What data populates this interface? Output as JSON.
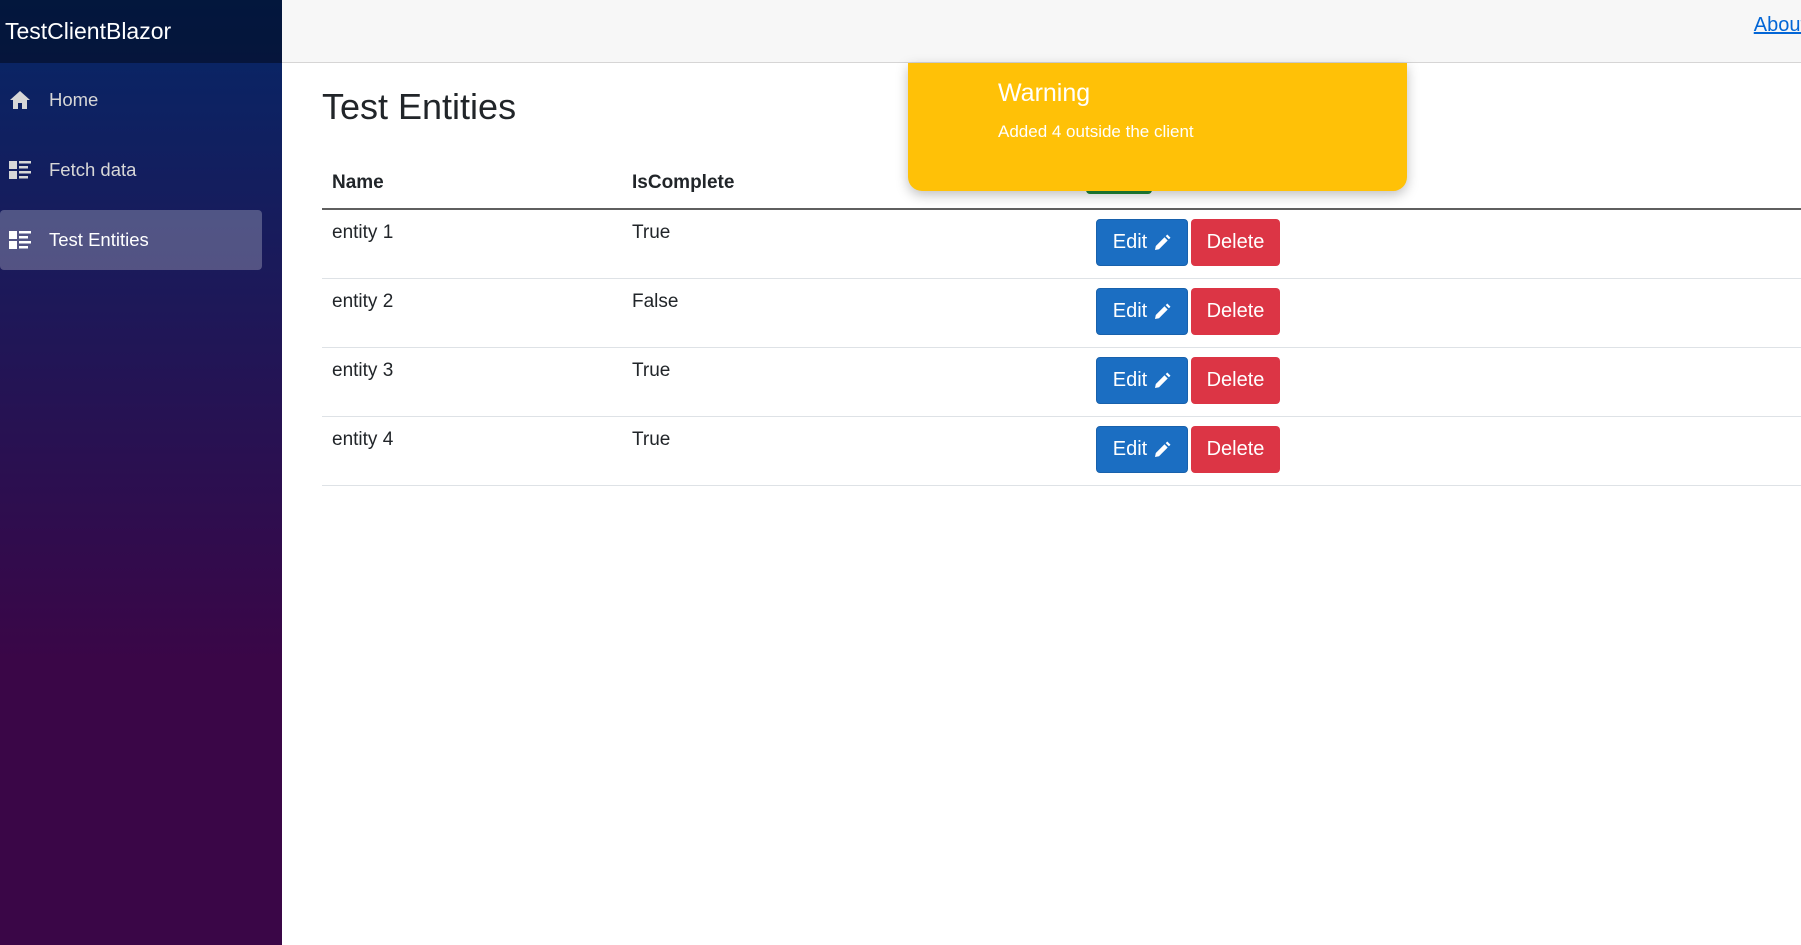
{
  "app": {
    "brand": "TestClientBlazor",
    "about_link": "About"
  },
  "sidebar": {
    "items": [
      {
        "label": "Home",
        "icon": "home-icon",
        "active": false
      },
      {
        "label": "Fetch data",
        "icon": "list-icon",
        "active": false
      },
      {
        "label": "Test Entities",
        "icon": "list-icon",
        "active": true
      }
    ]
  },
  "main": {
    "title": "Test Entities",
    "table": {
      "headers": [
        "Name",
        "IsComplete"
      ],
      "rows": [
        {
          "name": "entity 1",
          "complete": "True"
        },
        {
          "name": "entity 2",
          "complete": "False"
        },
        {
          "name": "entity 3",
          "complete": "True"
        },
        {
          "name": "entity 4",
          "complete": "True"
        }
      ]
    },
    "edit_label": "Edit",
    "delete_label": "Delete"
  },
  "toast": {
    "title": "Warning",
    "body": "Added 4 outside the client",
    "color": "#ffc107"
  },
  "colors": {
    "sidebar_top": "#052767",
    "sidebar_bottom": "#3a0647",
    "edit_button": "#1b6ec2",
    "delete_button": "#dc3545",
    "link": "#0366d6"
  }
}
